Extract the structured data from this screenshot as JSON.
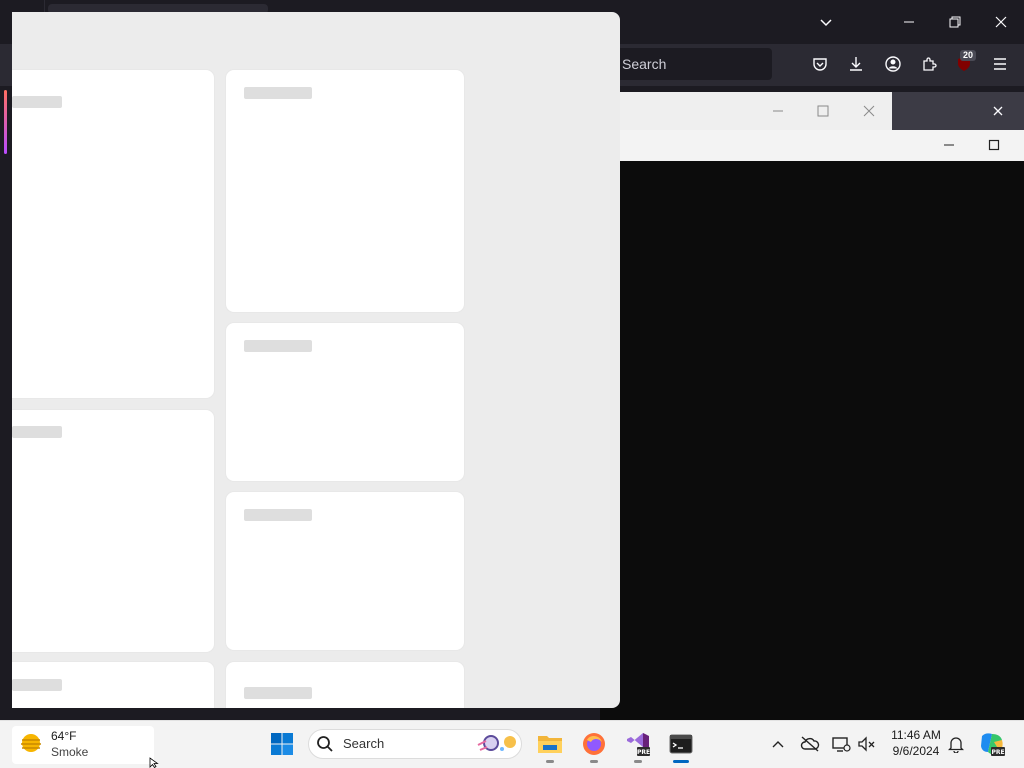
{
  "browser": {
    "search_placeholder": "Search",
    "addon_badge": "20"
  },
  "widgets": {
    "cards": 7
  },
  "taskbar": {
    "weather_temp": "64°F",
    "weather_condition": "Smoke",
    "search_label": "Search",
    "clock_time": "11:46 AM",
    "clock_date": "9/6/2024",
    "apps": [
      "start-icon",
      "file-explorer-icon",
      "firefox-icon",
      "visual-studio-icon",
      "terminal-icon"
    ]
  },
  "colors": {
    "firefox_bg": "#1c1b22",
    "firefox_toolbar": "#2b2a33",
    "widgets_panel": "#ececec",
    "taskbar": "#f3f3f3",
    "terminal_bg": "#0c0c0c",
    "accent_blue": "#0067c0"
  }
}
